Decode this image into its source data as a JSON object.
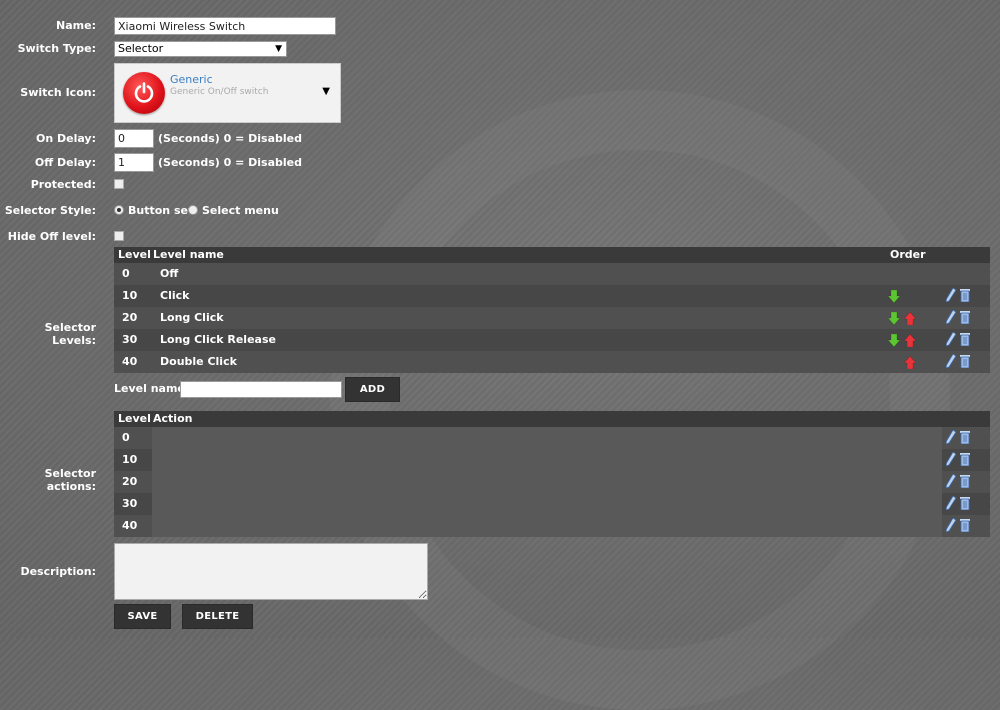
{
  "form": {
    "name_label": "Name:",
    "name_value": "Xiaomi Wireless Switch",
    "switch_type_label": "Switch Type:",
    "switch_type_value": "Selector",
    "switch_icon_label": "Switch Icon:",
    "icon_name": "Generic",
    "icon_desc": "Generic On/Off switch",
    "on_delay_label": "On Delay:",
    "on_delay_value": "0",
    "on_delay_hint": "(Seconds) 0 = Disabled",
    "off_delay_label": "Off Delay:",
    "off_delay_value": "1",
    "off_delay_hint": "(Seconds) 0 = Disabled",
    "protected_label": "Protected:",
    "protected_checked": false,
    "selector_style_label": "Selector Style:",
    "style_option_button": "Button set",
    "style_option_select": "Select menu",
    "style_selected": "Button set",
    "hide_off_label": "Hide Off level:",
    "hide_off_checked": false,
    "selector_levels_label": "Selector Levels:",
    "selector_actions_label": "Selector actions:",
    "description_label": "Description:",
    "description_value": ""
  },
  "levels_table": {
    "headers": {
      "level": "Level",
      "name": "Level name",
      "order": "Order"
    },
    "rows": [
      {
        "level": "0",
        "name": "Off",
        "down": false,
        "up": false,
        "tools": false
      },
      {
        "level": "10",
        "name": "Click",
        "down": true,
        "up": false,
        "tools": true
      },
      {
        "level": "20",
        "name": "Long Click",
        "down": true,
        "up": true,
        "tools": true
      },
      {
        "level": "30",
        "name": "Long Click Release",
        "down": true,
        "up": true,
        "tools": true
      },
      {
        "level": "40",
        "name": "Double Click",
        "down": false,
        "up": true,
        "tools": true
      }
    ]
  },
  "add_level": {
    "label": "Level name:",
    "value": "",
    "button": "ADD"
  },
  "actions_table": {
    "headers": {
      "level": "Level",
      "action": "Action"
    },
    "rows": [
      {
        "level": "0",
        "action": ""
      },
      {
        "level": "10",
        "action": ""
      },
      {
        "level": "20",
        "action": ""
      },
      {
        "level": "30",
        "action": ""
      },
      {
        "level": "40",
        "action": ""
      }
    ]
  },
  "buttons": {
    "save": "SAVE",
    "delete": "DELETE"
  },
  "icons": {
    "power": "power-icon",
    "arrow_down": "arrow-down-icon",
    "arrow_up": "arrow-up-icon",
    "edit": "pencil-icon",
    "delete": "trash-icon"
  },
  "colors": {
    "down_arrow": "#5cc531",
    "up_arrow": "#e8333b",
    "icon_name": "#3b7fc2",
    "power": "#e0141b"
  }
}
